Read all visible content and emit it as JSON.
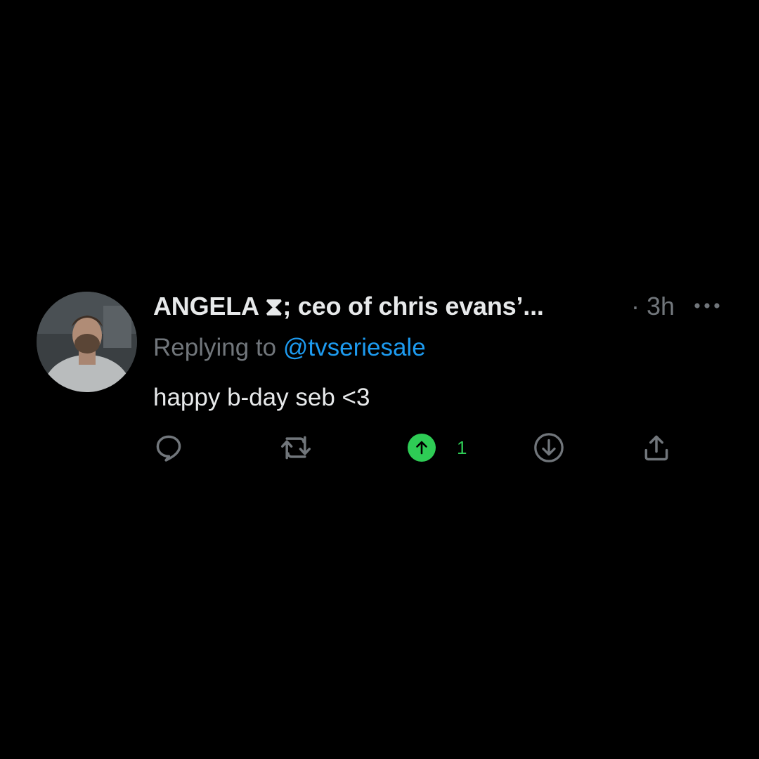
{
  "tweet": {
    "display_name": "ANGELA ⧗; ceo of chris evans’...",
    "timestamp": "· 3h",
    "replying_prefix": "Replying to",
    "replying_handle": "@tvseriesale",
    "text": "happy b-day seb <3",
    "avatar_icon": "profile-photo",
    "more_icon": "more-dots-icon"
  },
  "actions": {
    "reply_icon": "reply-icon",
    "retweet_icon": "retweet-icon",
    "upvote_icon": "upvote-arrow-icon",
    "upvote_count": "1",
    "downvote_icon": "downvote-arrow-icon",
    "share_icon": "share-icon"
  },
  "colors": {
    "background": "#000000",
    "primary_text": "#e7e9ea",
    "secondary_text": "#71767b",
    "link": "#1d9bf0",
    "upvote": "#2ecc55"
  }
}
